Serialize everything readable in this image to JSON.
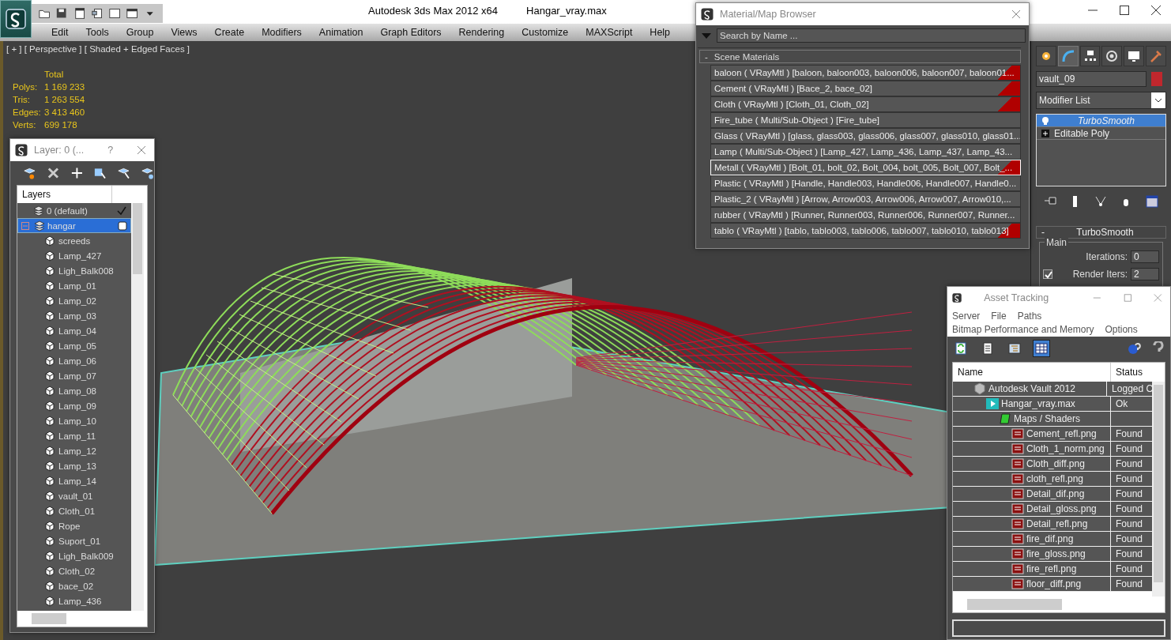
{
  "title_bar": {
    "app_title": "Autodesk 3ds Max  2012 x64",
    "file_name": "Hangar_vray.max"
  },
  "menu": [
    "Edit",
    "Tools",
    "Group",
    "Views",
    "Create",
    "Modifiers",
    "Animation",
    "Graph Editors",
    "Rendering",
    "Customize",
    "MAXScript",
    "Help"
  ],
  "viewport": {
    "label": "[ + ] [ Perspective ] [ Shaded + Edged Faces ]",
    "stats_header": "Total",
    "stats": [
      {
        "label": "Polys:",
        "value": "1 169 233"
      },
      {
        "label": "Tris:",
        "value": "1 263 554"
      },
      {
        "label": "Edges:",
        "value": "3 413 460"
      },
      {
        "label": "Verts:",
        "value": "699 178"
      }
    ]
  },
  "layer_window": {
    "title": "Layer: 0 (...",
    "help": "?",
    "column": "Layers",
    "layers": [
      {
        "name": "0 (default)",
        "current": true,
        "selected": false
      },
      {
        "name": "hangar",
        "current": false,
        "selected": true,
        "expanded": true,
        "children": [
          {
            "name": "screeds"
          },
          {
            "name": "Lamp_427"
          },
          {
            "name": "Ligh_Balk008"
          },
          {
            "name": "Lamp_01"
          },
          {
            "name": "Lamp_02"
          },
          {
            "name": "Lamp_03"
          },
          {
            "name": "Lamp_04"
          },
          {
            "name": "Lamp_05"
          },
          {
            "name": "Lamp_06"
          },
          {
            "name": "Lamp_07"
          },
          {
            "name": "Lamp_08"
          },
          {
            "name": "Lamp_09"
          },
          {
            "name": "Lamp_10"
          },
          {
            "name": "Lamp_11"
          },
          {
            "name": "Lamp_12"
          },
          {
            "name": "Lamp_13"
          },
          {
            "name": "Lamp_14"
          },
          {
            "name": "vault_01"
          },
          {
            "name": "Cloth_01"
          },
          {
            "name": "Rope"
          },
          {
            "name": "Suport_01"
          },
          {
            "name": "Ligh_Balk009"
          },
          {
            "name": "Cloth_02"
          },
          {
            "name": "bace_02"
          },
          {
            "name": "Lamp_436"
          }
        ]
      }
    ]
  },
  "material_browser": {
    "title": "Material/Map Browser",
    "search": {
      "placeholder": "Search by Name ..."
    },
    "group": {
      "toggle": "-",
      "label": "Scene Materials"
    },
    "materials": [
      {
        "text": "baloon ( VRayMtl ) [baloon, baloon003, baloon006, baloon007, baloon01...",
        "flagged": true,
        "selected": false
      },
      {
        "text": "Cement ( VRayMtl ) [Bace_2, bace_02]",
        "flagged": true,
        "selected": false
      },
      {
        "text": "Cloth ( VRayMtl ) [Cloth_01, Cloth_02]",
        "flagged": true,
        "selected": false
      },
      {
        "text": "Fire_tube ( Multi/Sub-Object ) [Fire_tube]",
        "flagged": false,
        "selected": false
      },
      {
        "text": "Glass ( VRayMtl ) [glass, glass003, glass006, glass007, glass010, glass01...",
        "flagged": false,
        "selected": false
      },
      {
        "text": "Lamp ( Multi/Sub-Object ) [Lamp_427, Lamp_436, Lamp_437, Lamp_43...",
        "flagged": false,
        "selected": false
      },
      {
        "text": "Metall ( VRayMtl ) [Bolt_01, bolt_02, Bolt_004, bolt_005, Bolt_007, Bolt_...",
        "flagged": true,
        "selected": true
      },
      {
        "text": "Plastic ( VRayMtl ) [Handle, Handle003, Handle006, Handle007, Handle0...",
        "flagged": false,
        "selected": false
      },
      {
        "text": "Plastic_2 ( VRayMtl ) [Arrow, Arrow003, Arrow006, Arrow007, Arrow010,...",
        "flagged": false,
        "selected": false
      },
      {
        "text": "rubber ( VRayMtl ) [Runner, Runner003, Runner006, Runner007, Runner...",
        "flagged": false,
        "selected": false
      },
      {
        "text": "tablo ( VRayMtl ) [tablo, tablo003, tablo006, tablo007, tablo010, tablo013]",
        "flagged": true,
        "selected": false
      }
    ]
  },
  "command_panel": {
    "tabs": [
      {
        "kind": "create",
        "selected": false
      },
      {
        "kind": "modify",
        "selected": true
      },
      {
        "kind": "hierarchy",
        "selected": false
      },
      {
        "kind": "motion",
        "selected": false
      },
      {
        "kind": "display",
        "selected": false
      },
      {
        "kind": "utilities",
        "selected": false
      }
    ],
    "object_name": "vault_09",
    "modifier_list": "Modifier List",
    "stack": [
      {
        "name": "TurboSmooth",
        "kind": "modifier",
        "selected": true
      },
      {
        "name": "Editable Poly",
        "kind": "base",
        "selected": false
      }
    ],
    "rollout": {
      "toggle": "-",
      "title": "TurboSmooth",
      "group": "Main",
      "iterations": {
        "label": "Iterations:",
        "value": "0"
      },
      "render_iters": {
        "label": "Render Iters:",
        "value": "2",
        "checked": true
      }
    }
  },
  "asset_tracking": {
    "title": "Asset Tracking",
    "menu": [
      "Server",
      "File",
      "Paths",
      "Bitmap Performance and Memory",
      "Options"
    ],
    "toolbar": [
      {
        "kind": "refresh",
        "selected": false
      },
      {
        "kind": "list",
        "selected": false
      },
      {
        "kind": "tree",
        "selected": false
      },
      {
        "kind": "table",
        "selected": true
      }
    ],
    "columns": [
      "Name",
      "Status"
    ],
    "rows": [
      {
        "name": "Autodesk Vault 2012",
        "status": "Logged O",
        "kind": "vault",
        "children": [
          {
            "name": "Hangar_vray.max",
            "status": "Ok",
            "kind": "scene",
            "children": [
              {
                "name": "Maps / Shaders",
                "kind": "folder",
                "children": [
                  {
                    "name": "Cement_refl.png",
                    "status": "Found",
                    "kind": "png"
                  },
                  {
                    "name": "Cloth_1_norm.png",
                    "status": "Found",
                    "kind": "png"
                  },
                  {
                    "name": "Cloth_diff.png",
                    "status": "Found",
                    "kind": "png"
                  },
                  {
                    "name": "cloth_refl.png",
                    "status": "Found",
                    "kind": "png"
                  },
                  {
                    "name": "Detail_dif.png",
                    "status": "Found",
                    "kind": "png"
                  },
                  {
                    "name": "Detail_gloss.png",
                    "status": "Found",
                    "kind": "png"
                  },
                  {
                    "name": "Detail_refl.png",
                    "status": "Found",
                    "kind": "png"
                  },
                  {
                    "name": "fire_dif.png",
                    "status": "Found",
                    "kind": "png"
                  },
                  {
                    "name": "fire_gloss.png",
                    "status": "Found",
                    "kind": "png"
                  },
                  {
                    "name": "fire_refl.png",
                    "status": "Found",
                    "kind": "png"
                  },
                  {
                    "name": "floor_diff.png",
                    "status": "Found",
                    "kind": "png"
                  }
                ]
              }
            ]
          }
        ]
      }
    ]
  }
}
